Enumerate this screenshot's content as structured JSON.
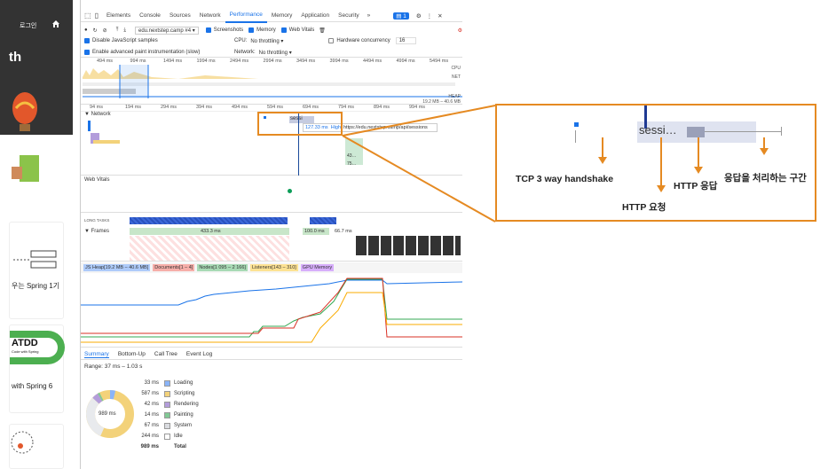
{
  "left": {
    "login": "로그인",
    "big_text": "th",
    "card1": "우는 Spring 1기",
    "card2_logo": "ATDD",
    "card2_sub": "Code with Spring",
    "card2_text": "with Spring 6"
  },
  "devtools": {
    "tabs": [
      "Elements",
      "Console",
      "Sources",
      "Network",
      "Performance",
      "Memory",
      "Application",
      "Security"
    ],
    "badge": "1",
    "url": "edu.nextstep.camp #4",
    "screenshots": "Screenshots",
    "memory": "Memory",
    "webvitals": "Web Vitals",
    "disable_js": "Disable JavaScript samples",
    "cpu_label": "CPU:",
    "cpu_value": "No throttling",
    "hw_label": "Hardware concurrency",
    "hw_value": "16",
    "paint_instr": "Enable advanced paint instrumentation (slow)",
    "net_label": "Network:",
    "net_value": "No throttling",
    "overview_ticks": [
      "494 ms",
      "994 ms",
      "1494 ms",
      "1994 ms",
      "2494 ms",
      "2994 ms",
      "3494 ms",
      "3994 ms",
      "4494 ms",
      "4994 ms",
      "5494 ms"
    ],
    "cpu": "CPU",
    "net": "NET",
    "heap": "HEAP",
    "heap_range": "19.2 MB – 40.6 MB",
    "ruler_ticks": [
      "94 ms",
      "194 ms",
      "294 ms",
      "394 ms",
      "494 ms",
      "594 ms",
      "694 ms",
      "794 ms",
      "894 ms",
      "994 ms"
    ],
    "network": "▼ Network",
    "req_label": "sessi",
    "tooltip_time": "127.33 ms",
    "tooltip_prio": "High",
    "tooltip_url": "https://edu.nextstep.camp/api/sessions",
    "web_vitals": "Web Vitals",
    "long_tasks": "LONG TASKS",
    "frames": "▼ Frames",
    "frame1": "433.3 ms",
    "frame2": "100.0 ms",
    "frame3": "66.7 ms",
    "counters": [
      "JS Heap[19.2 MB – 40.6 MB]",
      "Documents[1 – 4]",
      "Nodes[1 095 – 2 166]",
      "Listeners[143 – 310]",
      "GPU Memory"
    ],
    "sum_tabs": [
      "Summary",
      "Bottom-Up",
      "Call Tree",
      "Event Log"
    ],
    "range": "Range: 37 ms – 1.03 s",
    "donut_label": "989 ms",
    "legend": [
      {
        "ms": "33 ms",
        "label": "Loading",
        "color": "#8ab4f8"
      },
      {
        "ms": "587 ms",
        "label": "Scripting",
        "color": "#f3d27a"
      },
      {
        "ms": "42 ms",
        "label": "Rendering",
        "color": "#b39ddb"
      },
      {
        "ms": "14 ms",
        "label": "Painting",
        "color": "#81c995"
      },
      {
        "ms": "67 ms",
        "label": "System",
        "color": "#dadce0"
      },
      {
        "ms": "244 ms",
        "label": "Idle",
        "color": "#ffffff"
      },
      {
        "ms": "989 ms",
        "label": "Total",
        "color": ""
      }
    ]
  },
  "annotation": {
    "zoom_label": "sessi…",
    "tcp": "TCP 3 way handshake",
    "http_req": "HTTP 요청",
    "http_res": "HTTP 응답",
    "processing": "응답을 처리하는 구간"
  }
}
